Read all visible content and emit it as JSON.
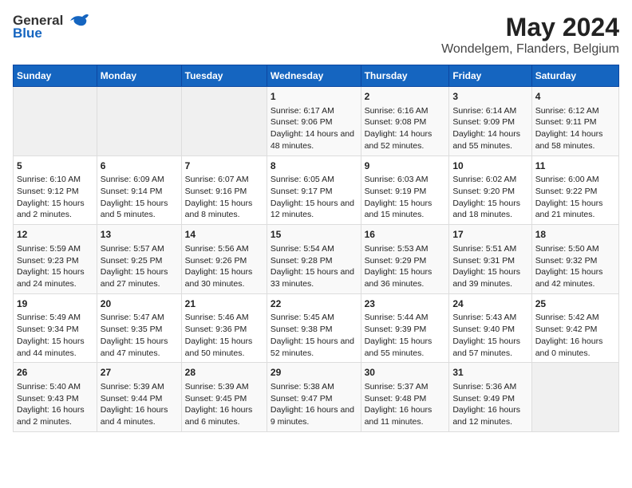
{
  "header": {
    "logo_general": "General",
    "logo_blue": "Blue",
    "title": "May 2024",
    "subtitle": "Wondelgem, Flanders, Belgium"
  },
  "days_of_week": [
    "Sunday",
    "Monday",
    "Tuesday",
    "Wednesday",
    "Thursday",
    "Friday",
    "Saturday"
  ],
  "weeks": [
    [
      {
        "day": "",
        "empty": true
      },
      {
        "day": "",
        "empty": true
      },
      {
        "day": "",
        "empty": true
      },
      {
        "day": "1",
        "sunrise": "Sunrise: 6:17 AM",
        "sunset": "Sunset: 9:06 PM",
        "daylight": "Daylight: 14 hours and 48 minutes."
      },
      {
        "day": "2",
        "sunrise": "Sunrise: 6:16 AM",
        "sunset": "Sunset: 9:08 PM",
        "daylight": "Daylight: 14 hours and 52 minutes."
      },
      {
        "day": "3",
        "sunrise": "Sunrise: 6:14 AM",
        "sunset": "Sunset: 9:09 PM",
        "daylight": "Daylight: 14 hours and 55 minutes."
      },
      {
        "day": "4",
        "sunrise": "Sunrise: 6:12 AM",
        "sunset": "Sunset: 9:11 PM",
        "daylight": "Daylight: 14 hours and 58 minutes."
      }
    ],
    [
      {
        "day": "5",
        "sunrise": "Sunrise: 6:10 AM",
        "sunset": "Sunset: 9:12 PM",
        "daylight": "Daylight: 15 hours and 2 minutes."
      },
      {
        "day": "6",
        "sunrise": "Sunrise: 6:09 AM",
        "sunset": "Sunset: 9:14 PM",
        "daylight": "Daylight: 15 hours and 5 minutes."
      },
      {
        "day": "7",
        "sunrise": "Sunrise: 6:07 AM",
        "sunset": "Sunset: 9:16 PM",
        "daylight": "Daylight: 15 hours and 8 minutes."
      },
      {
        "day": "8",
        "sunrise": "Sunrise: 6:05 AM",
        "sunset": "Sunset: 9:17 PM",
        "daylight": "Daylight: 15 hours and 12 minutes."
      },
      {
        "day": "9",
        "sunrise": "Sunrise: 6:03 AM",
        "sunset": "Sunset: 9:19 PM",
        "daylight": "Daylight: 15 hours and 15 minutes."
      },
      {
        "day": "10",
        "sunrise": "Sunrise: 6:02 AM",
        "sunset": "Sunset: 9:20 PM",
        "daylight": "Daylight: 15 hours and 18 minutes."
      },
      {
        "day": "11",
        "sunrise": "Sunrise: 6:00 AM",
        "sunset": "Sunset: 9:22 PM",
        "daylight": "Daylight: 15 hours and 21 minutes."
      }
    ],
    [
      {
        "day": "12",
        "sunrise": "Sunrise: 5:59 AM",
        "sunset": "Sunset: 9:23 PM",
        "daylight": "Daylight: 15 hours and 24 minutes."
      },
      {
        "day": "13",
        "sunrise": "Sunrise: 5:57 AM",
        "sunset": "Sunset: 9:25 PM",
        "daylight": "Daylight: 15 hours and 27 minutes."
      },
      {
        "day": "14",
        "sunrise": "Sunrise: 5:56 AM",
        "sunset": "Sunset: 9:26 PM",
        "daylight": "Daylight: 15 hours and 30 minutes."
      },
      {
        "day": "15",
        "sunrise": "Sunrise: 5:54 AM",
        "sunset": "Sunset: 9:28 PM",
        "daylight": "Daylight: 15 hours and 33 minutes."
      },
      {
        "day": "16",
        "sunrise": "Sunrise: 5:53 AM",
        "sunset": "Sunset: 9:29 PM",
        "daylight": "Daylight: 15 hours and 36 minutes."
      },
      {
        "day": "17",
        "sunrise": "Sunrise: 5:51 AM",
        "sunset": "Sunset: 9:31 PM",
        "daylight": "Daylight: 15 hours and 39 minutes."
      },
      {
        "day": "18",
        "sunrise": "Sunrise: 5:50 AM",
        "sunset": "Sunset: 9:32 PM",
        "daylight": "Daylight: 15 hours and 42 minutes."
      }
    ],
    [
      {
        "day": "19",
        "sunrise": "Sunrise: 5:49 AM",
        "sunset": "Sunset: 9:34 PM",
        "daylight": "Daylight: 15 hours and 44 minutes."
      },
      {
        "day": "20",
        "sunrise": "Sunrise: 5:47 AM",
        "sunset": "Sunset: 9:35 PM",
        "daylight": "Daylight: 15 hours and 47 minutes."
      },
      {
        "day": "21",
        "sunrise": "Sunrise: 5:46 AM",
        "sunset": "Sunset: 9:36 PM",
        "daylight": "Daylight: 15 hours and 50 minutes."
      },
      {
        "day": "22",
        "sunrise": "Sunrise: 5:45 AM",
        "sunset": "Sunset: 9:38 PM",
        "daylight": "Daylight: 15 hours and 52 minutes."
      },
      {
        "day": "23",
        "sunrise": "Sunrise: 5:44 AM",
        "sunset": "Sunset: 9:39 PM",
        "daylight": "Daylight: 15 hours and 55 minutes."
      },
      {
        "day": "24",
        "sunrise": "Sunrise: 5:43 AM",
        "sunset": "Sunset: 9:40 PM",
        "daylight": "Daylight: 15 hours and 57 minutes."
      },
      {
        "day": "25",
        "sunrise": "Sunrise: 5:42 AM",
        "sunset": "Sunset: 9:42 PM",
        "daylight": "Daylight: 16 hours and 0 minutes."
      }
    ],
    [
      {
        "day": "26",
        "sunrise": "Sunrise: 5:40 AM",
        "sunset": "Sunset: 9:43 PM",
        "daylight": "Daylight: 16 hours and 2 minutes."
      },
      {
        "day": "27",
        "sunrise": "Sunrise: 5:39 AM",
        "sunset": "Sunset: 9:44 PM",
        "daylight": "Daylight: 16 hours and 4 minutes."
      },
      {
        "day": "28",
        "sunrise": "Sunrise: 5:39 AM",
        "sunset": "Sunset: 9:45 PM",
        "daylight": "Daylight: 16 hours and 6 minutes."
      },
      {
        "day": "29",
        "sunrise": "Sunrise: 5:38 AM",
        "sunset": "Sunset: 9:47 PM",
        "daylight": "Daylight: 16 hours and 9 minutes."
      },
      {
        "day": "30",
        "sunrise": "Sunrise: 5:37 AM",
        "sunset": "Sunset: 9:48 PM",
        "daylight": "Daylight: 16 hours and 11 minutes."
      },
      {
        "day": "31",
        "sunrise": "Sunrise: 5:36 AM",
        "sunset": "Sunset: 9:49 PM",
        "daylight": "Daylight: 16 hours and 12 minutes."
      },
      {
        "day": "",
        "empty": true
      }
    ]
  ]
}
